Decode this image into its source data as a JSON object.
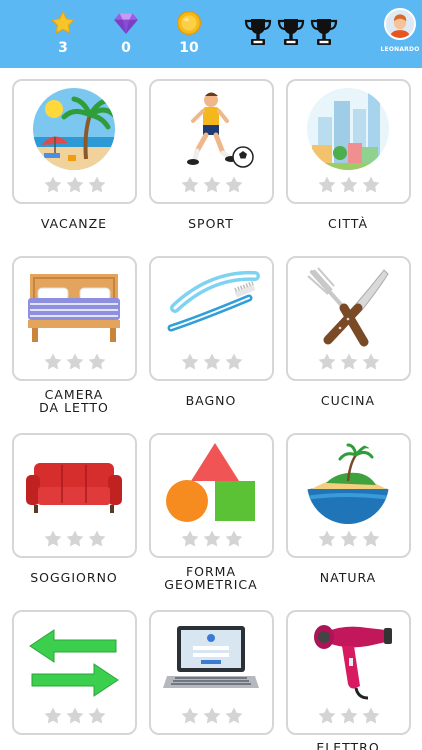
{
  "header": {
    "stars": {
      "icon": "star-icon",
      "value": "3"
    },
    "gems": {
      "icon": "diamond-icon",
      "value": "0"
    },
    "coins": {
      "icon": "coin-icon",
      "value": "10"
    },
    "trophies": [
      "trophy-icon",
      "trophy-icon",
      "trophy-icon"
    ],
    "profile": {
      "icon": "avatar-icon",
      "name": "LEONARDO"
    }
  },
  "categories": [
    {
      "label": "VACANZE",
      "picture": "beach-picture",
      "stars_earned": 0,
      "stars_total": 3
    },
    {
      "label": "SPORT",
      "picture": "soccer-player-picture",
      "stars_earned": 0,
      "stars_total": 3
    },
    {
      "label": "CITTÀ",
      "picture": "city-picture",
      "stars_earned": 0,
      "stars_total": 3
    },
    {
      "label": "CAMERA",
      "label_line2": "DA LETTO",
      "picture": "bed-picture",
      "stars_earned": 0,
      "stars_total": 3
    },
    {
      "label": "BAGNO",
      "picture": "toothbrush-picture",
      "stars_earned": 0,
      "stars_total": 3
    },
    {
      "label": "CUCINA",
      "picture": "fork-knife-picture",
      "stars_earned": 0,
      "stars_total": 3
    },
    {
      "label": "SOGGIORNO",
      "picture": "sofa-picture",
      "stars_earned": 0,
      "stars_total": 3
    },
    {
      "label": "FORMA",
      "label_line2": "GEOMETRICA",
      "picture": "shapes-picture",
      "stars_earned": 0,
      "stars_total": 3
    },
    {
      "label": "NATURA",
      "picture": "island-picture",
      "stars_earned": 0,
      "stars_total": 3
    },
    {
      "label": "",
      "picture": "arrows-picture",
      "stars_earned": 0,
      "stars_total": 3
    },
    {
      "label": "",
      "picture": "laptop-picture",
      "stars_earned": 0,
      "stars_total": 3
    },
    {
      "label": "ELETTRO",
      "picture": "hairdryer-picture",
      "stars_earned": 0,
      "stars_total": 3
    }
  ],
  "colors": {
    "header_bg": "#5bb8f2",
    "card_border": "#d6d6d6",
    "star_empty": "#d4d4d4",
    "star_filled": "#f6c21c"
  }
}
